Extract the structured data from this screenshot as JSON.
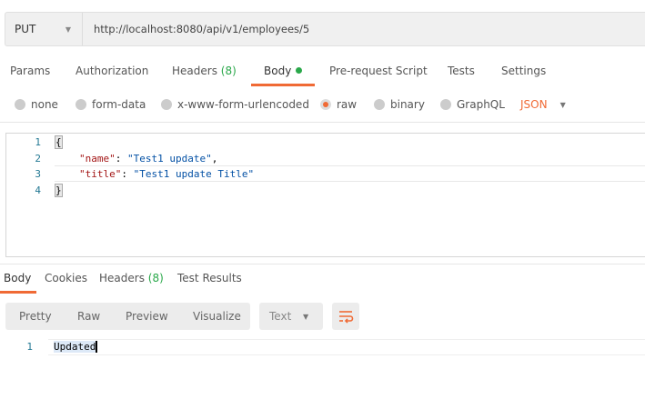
{
  "request": {
    "method": "PUT",
    "url": "http://localhost:8080/api/v1/employees/5"
  },
  "request_tabs": {
    "params": "Params",
    "authorization": "Authorization",
    "headers": "Headers",
    "headers_count": "(8)",
    "body": "Body",
    "prerequest": "Pre-request Script",
    "tests": "Tests",
    "settings": "Settings"
  },
  "body_types": {
    "none": "none",
    "form_data": "form-data",
    "urlencoded": "x-www-form-urlencoded",
    "raw": "raw",
    "binary": "binary",
    "graphql": "GraphQL",
    "format": "JSON",
    "selected": "raw"
  },
  "editor": {
    "lines": [
      "1",
      "2",
      "3",
      "4"
    ],
    "open": "{",
    "k1": "\"name\"",
    "v1": "\"Test1 update\"",
    "k2": "\"title\"",
    "v2": "\"Test1 update Title\"",
    "close": "}",
    "colon": ": ",
    "comma": ","
  },
  "response_tabs": {
    "body": "Body",
    "cookies": "Cookies",
    "headers": "Headers",
    "headers_count": "(8)",
    "test_results": "Test Results"
  },
  "response_toolbar": {
    "pretty": "Pretty",
    "raw": "Raw",
    "preview": "Preview",
    "visualize": "Visualize",
    "format": "Text"
  },
  "response": {
    "line": "1",
    "text": "Updated"
  },
  "colors": {
    "accent": "#f06a35",
    "green": "#2aa84a"
  }
}
